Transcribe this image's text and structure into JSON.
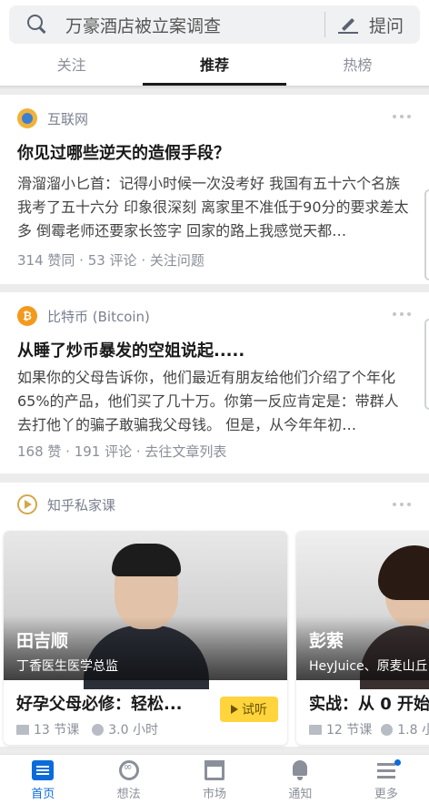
{
  "search": {
    "query": "万豪酒店被立案调查",
    "ask_label": "提问"
  },
  "tabs": [
    {
      "label": "关注",
      "active": false
    },
    {
      "label": "推荐",
      "active": true
    },
    {
      "label": "热榜",
      "active": false
    }
  ],
  "feed": [
    {
      "source": "互联网",
      "source_icon": "globe-icon",
      "title": "你见过哪些逆天的造假手段？",
      "excerpt": "滑溜溜小匕首：记得小时候一次没考好 我国有五十六个名族 我考了五十六分 印象很深刻 离家里不准低于90分的要求差太多 倒霉老师还要家长签字 回家的路上我感觉天都…",
      "meta": "314 赞同 · 53 评论 · 关注问题"
    },
    {
      "source": "比特币 (Bitcoin)",
      "source_icon": "bitcoin-icon",
      "title": "从睡了炒币暴发的空姐说起.....",
      "excerpt": "如果你的父母告诉你，他们最近有朋友给他们介绍了个年化65%的产品，他们买了几十万。你第一反应肯定是：带群人去打他丫的骗子敢骗我父母钱。 但是，从今年年初…",
      "meta": "168 赞 · 191 评论 · 去往文章列表"
    }
  ],
  "courses_section": {
    "source": "知乎私家课",
    "source_icon": "course-icon",
    "items": [
      {
        "instructor": "田吉顺",
        "instructor_title": "丁香医生医学总监",
        "title": "好孕父母必修：轻松...",
        "lessons": "13 节课",
        "hours": "3.0 小时",
        "trial_label": "试听"
      },
      {
        "instructor": "彭萦",
        "instructor_title": "HeyJuice、原麦山丘",
        "title": "实战：从 0 开始",
        "lessons": "12 节课",
        "hours": "1.8 小"
      }
    ]
  },
  "bottom_nav": [
    {
      "label": "首页",
      "icon": "home-icon",
      "active": true
    },
    {
      "label": "想法",
      "icon": "idea-icon",
      "active": false
    },
    {
      "label": "市场",
      "icon": "market-icon",
      "active": false
    },
    {
      "label": "通知",
      "icon": "bell-icon",
      "active": false
    },
    {
      "label": "更多",
      "icon": "menu-icon",
      "active": false,
      "badge_dot": true
    }
  ],
  "colors": {
    "accent": "#0a6cdb",
    "trial_button": "#ffd43d",
    "background": "#ececec"
  }
}
